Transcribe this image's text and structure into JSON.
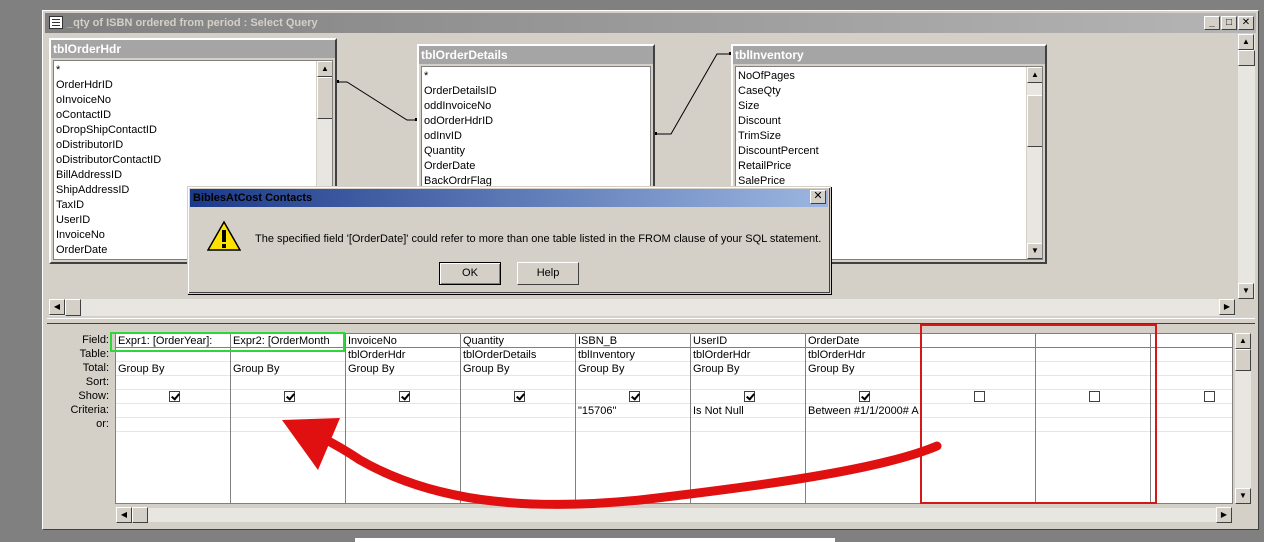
{
  "window": {
    "title": "_qty of ISBN ordered from period : Select Query",
    "minimize": "_",
    "maximize": "□",
    "close": "✕"
  },
  "tables": [
    {
      "name": "tblOrderHdr",
      "fields": [
        "*",
        "OrderHdrID",
        "oInvoiceNo",
        "oContactID",
        "oDropShipContactID",
        "oDistributorID",
        "oDistributorContactID",
        "BillAddressID",
        "ShipAddressID",
        "TaxID",
        "UserID",
        "InvoiceNo",
        "OrderDate"
      ]
    },
    {
      "name": "tblOrderDetails",
      "fields": [
        "*",
        "OrderDetailsID",
        "oddInvoiceNo",
        "odOrderHdrID",
        "odInvID",
        "Quantity",
        "OrderDate",
        "BackOrdrFlag"
      ]
    },
    {
      "name": "tblInventory",
      "fields": [
        "NoOfPages",
        "CaseQty",
        "Size",
        "Discount",
        "TrimSize",
        "DiscountPercent",
        "RetailPrice",
        "SalePrice"
      ]
    }
  ],
  "grid": {
    "row_labels": [
      "Field:",
      "Table:",
      "Total:",
      "Sort:",
      "Show:",
      "Criteria:",
      "or:"
    ],
    "columns": [
      {
        "field": "Expr1: [OrderYear]:",
        "table": "",
        "total": "Group By",
        "sort": "",
        "show": true,
        "criteria": "",
        "or": ""
      },
      {
        "field": "Expr2: [OrderMonth",
        "table": "",
        "total": "Group By",
        "sort": "",
        "show": true,
        "criteria": "",
        "or": ""
      },
      {
        "field": "InvoiceNo",
        "table": "tblOrderHdr",
        "total": "Group By",
        "sort": "",
        "show": true,
        "criteria": "",
        "or": ""
      },
      {
        "field": "Quantity",
        "table": "tblOrderDetails",
        "total": "Group By",
        "sort": "",
        "show": true,
        "criteria": "",
        "or": ""
      },
      {
        "field": "ISBN_B",
        "table": "tblInventory",
        "total": "Group By",
        "sort": "",
        "show": true,
        "criteria": "\"15706\"",
        "or": ""
      },
      {
        "field": "UserID",
        "table": "tblOrderHdr",
        "total": "Group By",
        "sort": "",
        "show": true,
        "criteria": "Is Not Null",
        "or": ""
      },
      {
        "field": "OrderDate",
        "table": "tblOrderHdr",
        "total": "Group By",
        "sort": "",
        "show": true,
        "criteria": "Between #1/1/2000# A",
        "or": ""
      },
      {
        "field": "",
        "table": "",
        "total": "",
        "sort": "",
        "show": false,
        "criteria": "",
        "or": ""
      },
      {
        "field": "",
        "table": "",
        "total": "",
        "sort": "",
        "show": false,
        "criteria": "",
        "or": ""
      },
      {
        "field": "",
        "table": "",
        "total": "",
        "sort": "",
        "show": false,
        "criteria": "",
        "or": ""
      }
    ]
  },
  "dialog": {
    "title": "BiblesAtCost Contacts",
    "message": "The specified field '[OrderDate]' could refer to more than one table listed in the FROM clause of your SQL statement.",
    "ok_label": "OK",
    "help_label": "Help",
    "close": "✕",
    "icon": "warning-icon"
  },
  "annotations": {
    "green_box_color": "#2ed63a",
    "red_box_color": "#d41717",
    "arrow_color": "#e01010"
  }
}
